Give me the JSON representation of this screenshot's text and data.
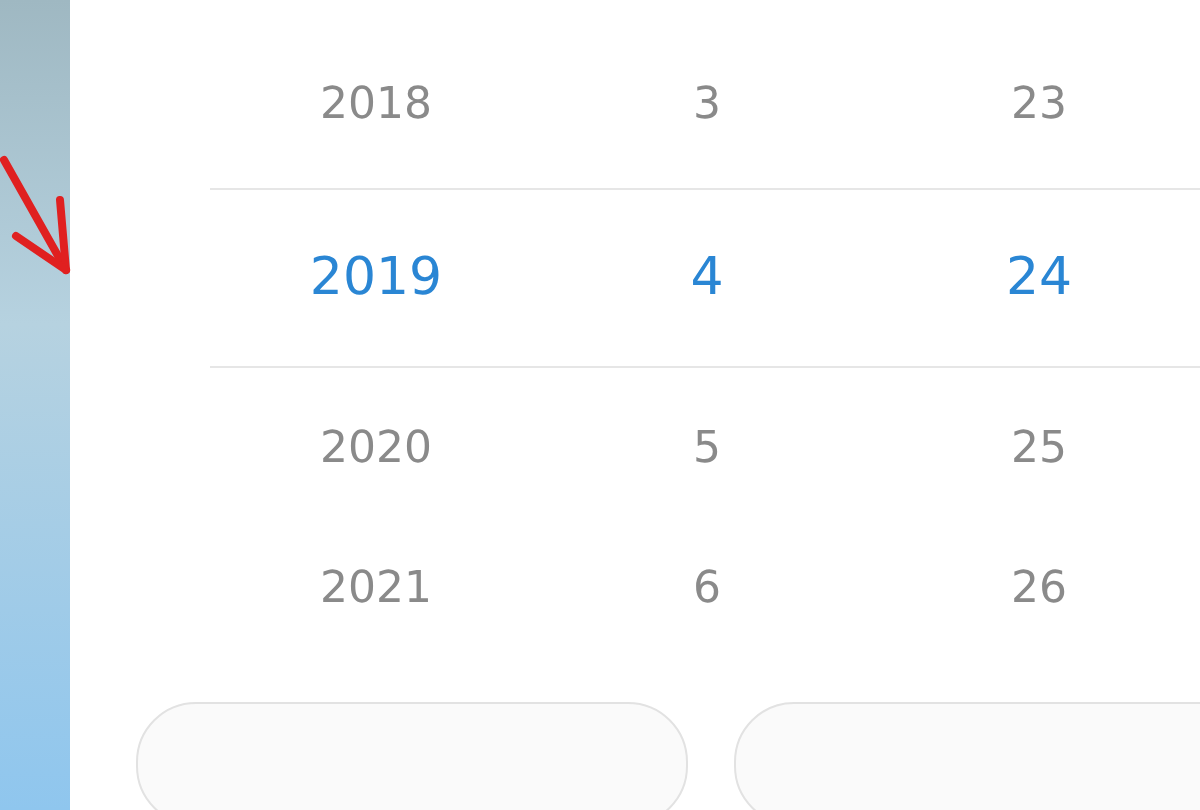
{
  "picker": {
    "rows": [
      {
        "cells": [
          "2018",
          "3",
          "23"
        ],
        "selected": false
      },
      {
        "cells": [
          "2019",
          "4",
          "24"
        ],
        "selected": true
      },
      {
        "cells": [
          "2020",
          "5",
          "25"
        ],
        "selected": false
      },
      {
        "cells": [
          "2021",
          "6",
          "26"
        ],
        "selected": false
      }
    ]
  }
}
